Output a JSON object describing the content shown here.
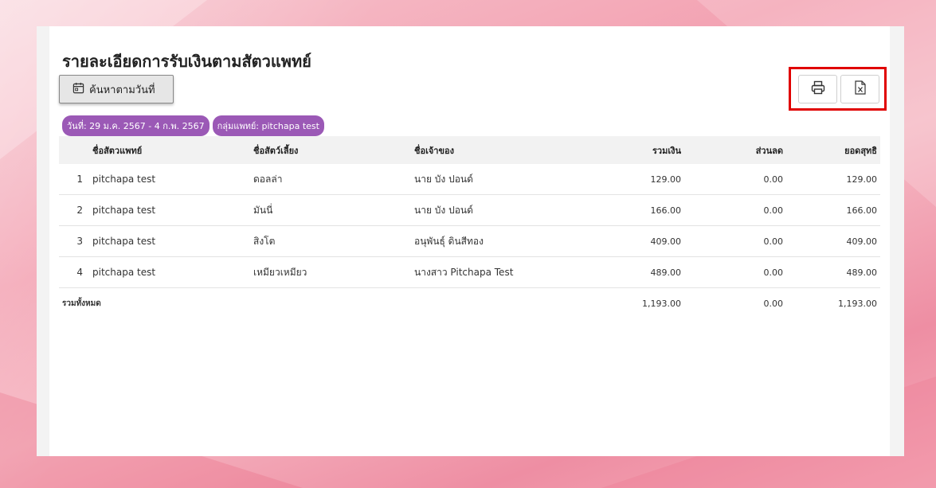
{
  "page": {
    "title": "รายละเอียดการรับเงินตามสัตวแพทย์",
    "search_button_label": "ค้นหาตามวันที่",
    "print_icon": "printer-icon",
    "excel_icon": "excel-file-icon",
    "highlight_color": "#e00000",
    "chip_color": "#9b59b6"
  },
  "filters": {
    "date_chip": "วันที่: 29 ม.ค. 2567 - 4 ก.พ. 2567",
    "doctor_chip": "กลุ่มแพทย์: pitchapa test"
  },
  "table": {
    "headers": {
      "vet_name": "ชื่อสัตวแพทย์",
      "pet_name": "ชื่อสัตว์เลี้ยง",
      "owner_name": "ชื่อเจ้าของ",
      "total": "รวมเงิน",
      "discount": "ส่วนลด",
      "net": "ยอดสุทธิ"
    },
    "rows": [
      {
        "index": "1",
        "vet": "pitchapa test",
        "pet": "ดอลล่า",
        "owner": "นาย บัง ปอนด์",
        "total": "129.00",
        "discount": "0.00",
        "net": "129.00"
      },
      {
        "index": "2",
        "vet": "pitchapa test",
        "pet": "มันนี่",
        "owner": "นาย บัง ปอนด์",
        "total": "166.00",
        "discount": "0.00",
        "net": "166.00"
      },
      {
        "index": "3",
        "vet": "pitchapa test",
        "pet": "สิงโต",
        "owner": "อนุพันธุ์ ดินสีทอง",
        "total": "409.00",
        "discount": "0.00",
        "net": "409.00"
      },
      {
        "index": "4",
        "vet": "pitchapa test",
        "pet": "เหมียวเหมียว",
        "owner": "นางสาว Pitchapa Test",
        "total": "489.00",
        "discount": "0.00",
        "net": "489.00"
      }
    ],
    "summary": {
      "label": "รวมทั้งหมด",
      "total": "1,193.00",
      "discount": "0.00",
      "net": "1,193.00"
    }
  }
}
